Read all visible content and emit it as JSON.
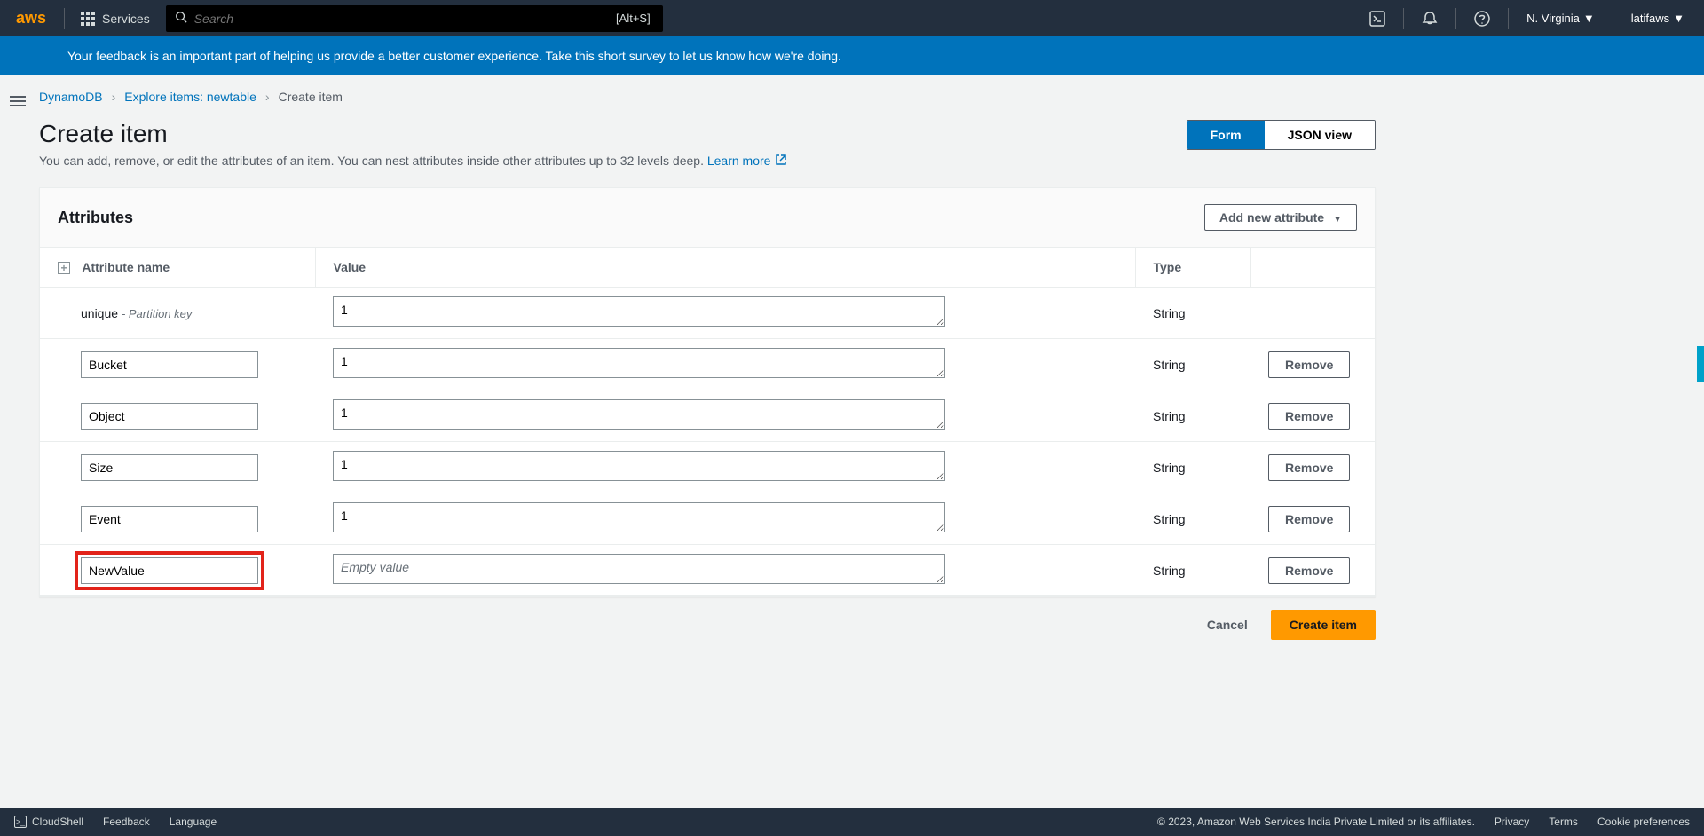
{
  "nav": {
    "logo": "aws",
    "services": "Services",
    "search_placeholder": "Search",
    "search_shortcut": "[Alt+S]",
    "region": "N. Virginia",
    "account": "latifaws"
  },
  "banner": {
    "text": "Your feedback is an important part of helping us provide a better customer experience. Take this short survey to let us know how we're doing."
  },
  "breadcrumb": {
    "items": [
      "DynamoDB",
      "Explore items: newtable",
      "Create item"
    ]
  },
  "header": {
    "title": "Create item",
    "subtitle": "You can add, remove, or edit the attributes of an item. You can nest attributes inside other attributes up to 32 levels deep. ",
    "learn_more": "Learn more",
    "view_form": "Form",
    "view_json": "JSON view"
  },
  "panel": {
    "title": "Attributes",
    "add_button": "Add new attribute",
    "columns": {
      "name": "Attribute name",
      "value": "Value",
      "type": "Type"
    },
    "remove_label": "Remove",
    "partition_key_label": "Partition key",
    "empty_placeholder": "Empty value",
    "rows": [
      {
        "name": "unique",
        "value": "1",
        "type": "String",
        "is_pk": true,
        "removable": false,
        "highlighted": false
      },
      {
        "name": "Bucket",
        "value": "1",
        "type": "String",
        "is_pk": false,
        "removable": true,
        "highlighted": false
      },
      {
        "name": "Object",
        "value": "1",
        "type": "String",
        "is_pk": false,
        "removable": true,
        "highlighted": false
      },
      {
        "name": "Size",
        "value": "1",
        "type": "String",
        "is_pk": false,
        "removable": true,
        "highlighted": false
      },
      {
        "name": "Event",
        "value": "1",
        "type": "String",
        "is_pk": false,
        "removable": true,
        "highlighted": false
      },
      {
        "name": "NewValue",
        "value": "",
        "type": "String",
        "is_pk": false,
        "removable": true,
        "highlighted": true
      }
    ]
  },
  "actions": {
    "cancel": "Cancel",
    "submit": "Create item"
  },
  "footer": {
    "cloudshell": "CloudShell",
    "feedback": "Feedback",
    "language": "Language",
    "copyright": "© 2023, Amazon Web Services India Private Limited or its affiliates.",
    "privacy": "Privacy",
    "terms": "Terms",
    "cookies": "Cookie preferences"
  }
}
